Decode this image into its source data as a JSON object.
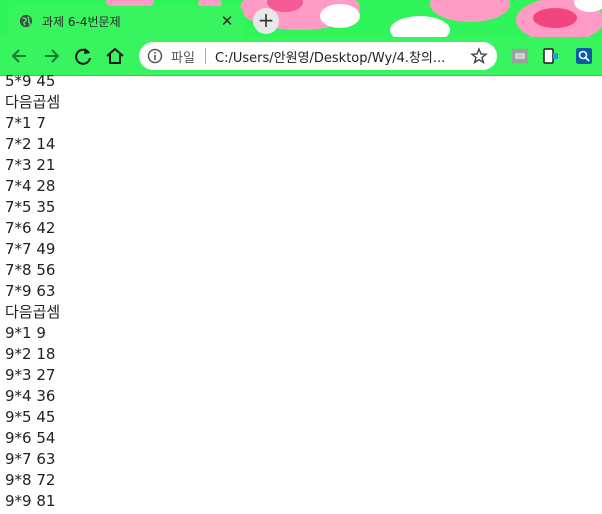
{
  "tab": {
    "title": "과제 6-4번문제",
    "close_glyph": "✕"
  },
  "new_tab_glyph": "+",
  "omnibox": {
    "scheme_label": "파일",
    "url": "C:/Users/안원영/Desktop/Wy/4.창의..."
  },
  "theme_colors": {
    "green": "#2ff55a",
    "pink": "#ff8fbf",
    "deep_pink": "#f2457f"
  },
  "content_lines": [
    "5*9 45",
    "다음곱셈",
    "7*1 7",
    "7*2 14",
    "7*3 21",
    "7*4 28",
    "7*5 35",
    "7*6 42",
    "7*7 49",
    "7*8 56",
    "7*9 63",
    "다음곱셈",
    "9*1 9",
    "9*2 18",
    "9*3 27",
    "9*4 36",
    "9*5 45",
    "9*6 54",
    "9*7 63",
    "9*8 72",
    "9*9 81"
  ],
  "icons": {
    "tab_favicon": "globe-icon",
    "back": "arrow-left-icon",
    "forward": "arrow-right-icon",
    "reload": "reload-icon",
    "home": "home-icon",
    "info": "info-icon",
    "bookmark": "star-icon",
    "extensions": [
      "extension-ex-icon",
      "extension-tablet-icon",
      "extension-search-icon"
    ]
  }
}
